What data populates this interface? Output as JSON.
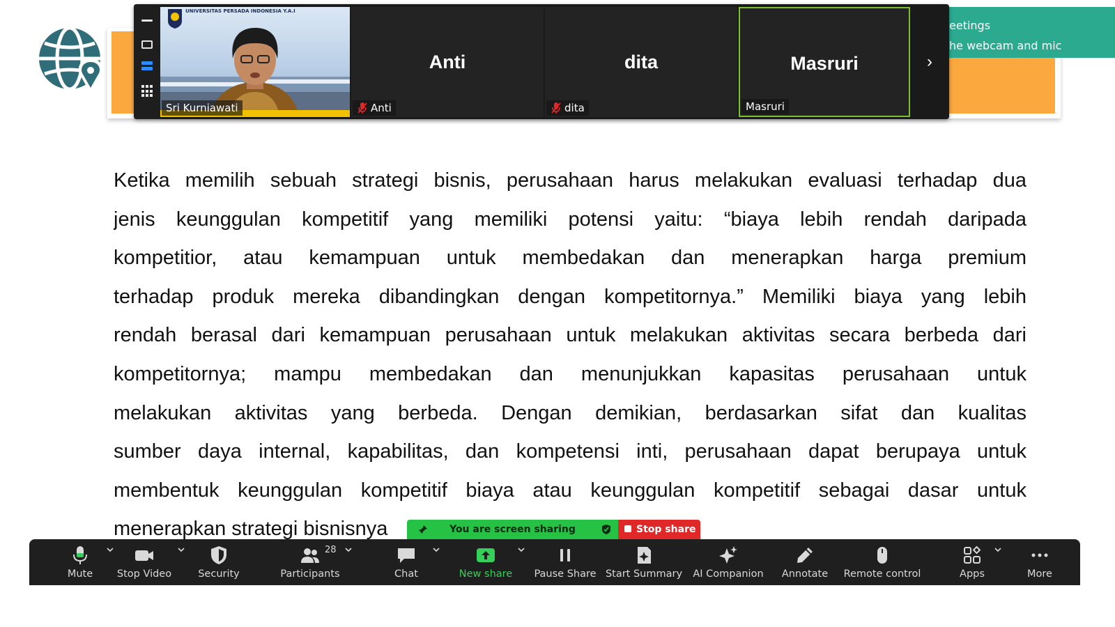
{
  "slide": {
    "banner_lines": [
      "eetings",
      "he webcam and mic"
    ],
    "paragraph_lines": [
      "Ketika memilih sebuah strategi bisnis, perusahaan harus melakukan evaluasi terhadap dua",
      "jenis keunggulan kompetitif yang memiliki potensi yaitu: “biaya lebih rendah daripada",
      "kompetitior, atau kemampuan untuk membedakan dan menerapkan harga premium",
      "terhadap produk mereka dibandingkan dengan kompetitornya.” Memiliki biaya yang lebih",
      "rendah berasal dari kemampuan perusahaan untuk melakukan aktivitas secara berbeda dari",
      "kompetitornya; mampu membedakan dan menunjukkan kapasitas perusahaan untuk",
      "melakukan aktivitas yang berbeda. Dengan demikian, berdasarkan sifat dan kualitas",
      "sumber daya internal, kapabilitas, dan kompetensi inti, perusahaan dapat berupaya untuk",
      "membentuk keunggulan kompetitif biaya atau keunggulan kompetitif sebagai dasar untuk",
      "menerapkan strategi bisnisnya"
    ]
  },
  "video_strip": {
    "participants": [
      {
        "name": "Sri Kurniawati",
        "display": "",
        "muted": false,
        "has_video": true,
        "org_text": "UNIVERSITAS PERSADA INDONESIA Y.A.I"
      },
      {
        "name": "Anti",
        "display": "Anti",
        "muted": true,
        "has_video": false
      },
      {
        "name": "dita",
        "display": "dita",
        "muted": true,
        "has_video": false
      },
      {
        "name": "Masruri",
        "display": "Masruri",
        "muted": false,
        "has_video": false,
        "active_speaker": true
      }
    ],
    "next_glyph": "›"
  },
  "share_bar": {
    "status_text": "You are screen sharing",
    "stop_label": "Stop share"
  },
  "toolbar": {
    "items": [
      {
        "label": "Mute",
        "icon": "microphone-icon"
      },
      {
        "label": "Stop Video",
        "icon": "video-camera-icon"
      },
      {
        "label": "Security",
        "icon": "shield-icon"
      },
      {
        "label": "Participants",
        "icon": "participants-icon",
        "count": "28"
      },
      {
        "label": "Chat",
        "icon": "chat-bubble-icon"
      },
      {
        "label": "New share",
        "icon": "share-screen-icon",
        "active": true
      },
      {
        "label": "Pause Share",
        "icon": "pause-icon"
      },
      {
        "label": "Start Summary",
        "icon": "summary-sparkle-icon"
      },
      {
        "label": "AI Companion",
        "icon": "ai-sparkle-icon"
      },
      {
        "label": "Annotate",
        "icon": "pencil-icon"
      },
      {
        "label": "Remote control",
        "icon": "mouse-icon"
      },
      {
        "label": "Apps",
        "icon": "apps-icon"
      },
      {
        "label": "More",
        "icon": "more-dots-icon"
      }
    ]
  },
  "colors": {
    "slide_orange": "#FBA83F",
    "slide_teal": "#2BAA90",
    "logo_teal": "#2F6E78",
    "share_green": "#25C245",
    "stop_red": "#E02828",
    "toolbar_bg": "#1F1F1F",
    "active_speaker_border": "#7DBF2F"
  }
}
